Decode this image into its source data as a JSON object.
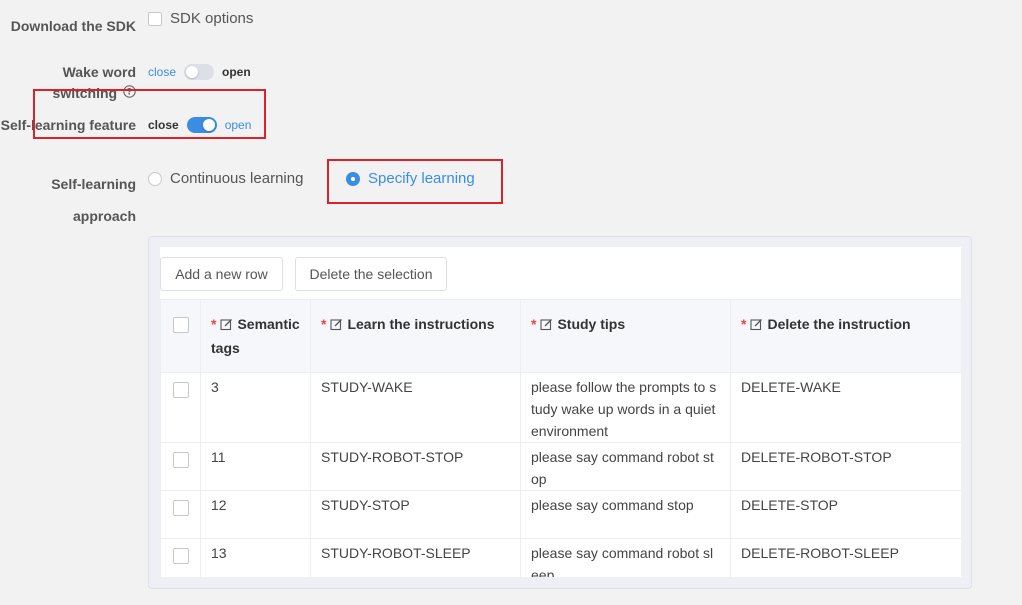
{
  "form": {
    "download_label": "Download the SDK",
    "sdk_options_label": "SDK options",
    "wake_label": "Wake word switching",
    "wake_close": "close",
    "wake_open": "open",
    "self_label": "Self-learning feature",
    "self_close": "close",
    "self_open": "open",
    "approach_label": "Self-learning approach",
    "approach_options": [
      "Continuous learning",
      "Specify learning"
    ],
    "approach_selected": "Specify learning"
  },
  "toolbar": {
    "add_label": "Add a new row",
    "delete_label": "Delete the selection"
  },
  "table": {
    "headers": [
      "Semantic tags",
      "Learn the instructions",
      "Study tips",
      "Delete the instruction"
    ],
    "rows": [
      [
        "3",
        "STUDY-WAKE",
        "please follow the prompts to study wake up words in a quiet environment",
        "DELETE-WAKE"
      ],
      [
        "11",
        "STUDY-ROBOT-STOP",
        "please say command robot stop",
        "DELETE-ROBOT-STOP"
      ],
      [
        "12",
        "STUDY-STOP",
        "please say command stop",
        "DELETE-STOP"
      ],
      [
        "13",
        "STUDY-ROBOT-SLEEP",
        "please say command robot sleep",
        "DELETE-ROBOT-SLEEP"
      ]
    ]
  },
  "colors": {
    "accent": "#3b8de4",
    "highlight_box": "#d9222a",
    "required_star": "#ee4444"
  },
  "icons": {
    "help": "question-circle-icon",
    "edit": "edit-icon"
  }
}
